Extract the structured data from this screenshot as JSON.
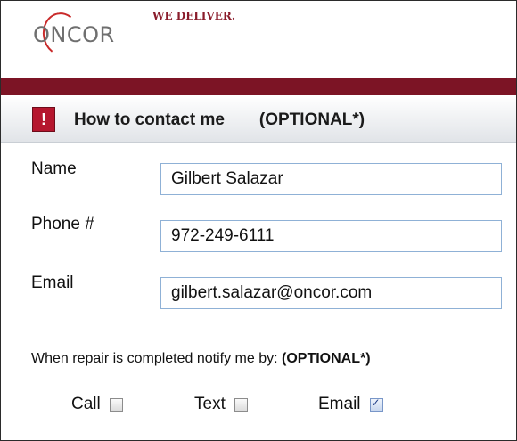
{
  "brand": {
    "logo_text": "ONCOR",
    "tagline": "WE DELIVER.",
    "bar_color": "#7c1425",
    "accent_red": "#b5162e"
  },
  "section": {
    "icon": "exclamation-icon",
    "icon_glyph": "!",
    "title": "How to contact me",
    "optional_label": "(OPTIONAL*)"
  },
  "form": {
    "name_label": "Name",
    "name_value": "Gilbert Salazar",
    "phone_label": "Phone #",
    "phone_value": "972-249-6111",
    "email_label": "Email",
    "email_value": "gilbert.salazar@oncor.com"
  },
  "notify": {
    "text": "When repair is completed notify me by: ",
    "optional": "(OPTIONAL*)",
    "options": [
      {
        "label": "Call",
        "checked": false
      },
      {
        "label": "Text",
        "checked": false
      },
      {
        "label": "Email",
        "checked": true
      }
    ]
  }
}
